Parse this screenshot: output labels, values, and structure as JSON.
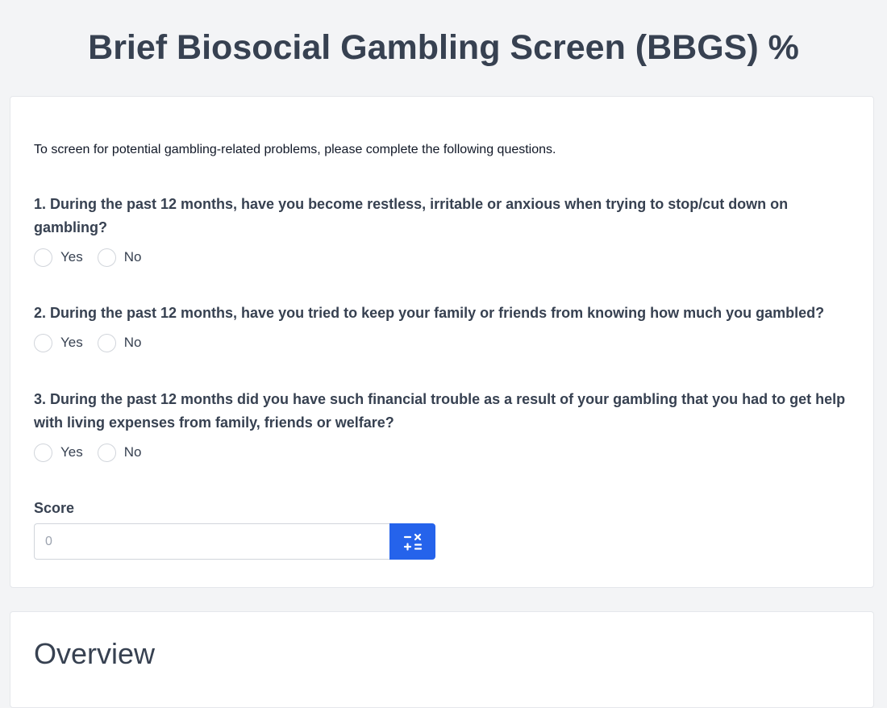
{
  "page": {
    "title": "Brief Biosocial Gambling Screen (BBGS) %"
  },
  "form": {
    "intro": "To screen for potential gambling-related problems, please complete the following questions.",
    "questions": [
      {
        "text": "1. During the past 12 months, have you become restless, irritable or anxious when trying to stop/cut down on gambling?",
        "options": [
          "Yes",
          "No"
        ]
      },
      {
        "text": "2. During the past 12 months, have you tried to keep your family or friends from knowing how much you gambled?",
        "options": [
          "Yes",
          "No"
        ]
      },
      {
        "text": "3. During the past 12 months did you have such financial trouble as a result of your gambling that you had to get help with living expenses from family, friends or welfare?",
        "options": [
          "Yes",
          "No"
        ]
      }
    ],
    "score": {
      "label": "Score",
      "placeholder": "0",
      "value": "",
      "button_icon": "calculator-icon"
    }
  },
  "overview": {
    "title": "Overview"
  },
  "colors": {
    "background": "#f3f4f6",
    "accent": "#2563eb",
    "text": "#374151"
  }
}
